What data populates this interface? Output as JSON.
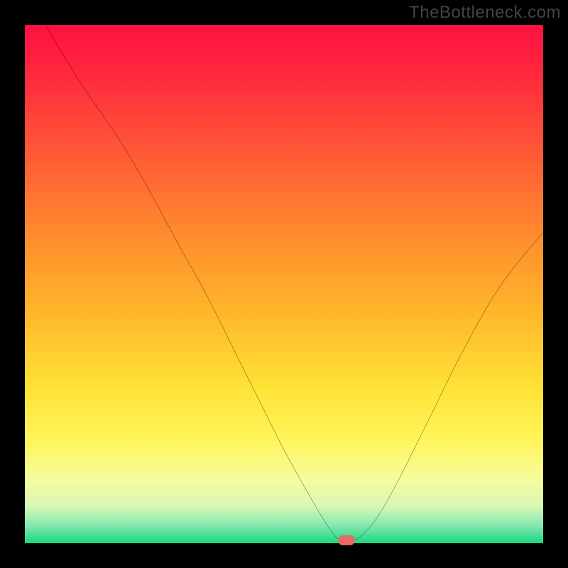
{
  "watermark": "TheBottleneck.com",
  "chart_data": {
    "type": "line",
    "title": "",
    "xlabel": "",
    "ylabel": "",
    "xlim": [
      0,
      100
    ],
    "ylim": [
      0,
      100
    ],
    "grid": false,
    "legend": false,
    "x": [
      4,
      10,
      20,
      30,
      35,
      40,
      45,
      50,
      55,
      58,
      60,
      61.5,
      63,
      65,
      68,
      72,
      78,
      85,
      92,
      100
    ],
    "values": [
      100,
      90,
      75,
      57,
      48,
      38,
      28,
      18,
      9,
      4,
      1.2,
      0.5,
      0.5,
      1.5,
      5,
      12,
      24,
      38,
      50,
      60
    ],
    "marker": {
      "x": 62,
      "y": 0.5
    },
    "gradient_stops": [
      {
        "pos": 0.0,
        "color": "#ff1041"
      },
      {
        "pos": 0.1,
        "color": "#ff2a3d"
      },
      {
        "pos": 0.25,
        "color": "#ff5a36"
      },
      {
        "pos": 0.4,
        "color": "#ff8a2e"
      },
      {
        "pos": 0.55,
        "color": "#ffb52a"
      },
      {
        "pos": 0.7,
        "color": "#ffe236"
      },
      {
        "pos": 0.8,
        "color": "#fff45a"
      },
      {
        "pos": 0.88,
        "color": "#f6fca0"
      },
      {
        "pos": 0.93,
        "color": "#d6f7b4"
      },
      {
        "pos": 0.965,
        "color": "#86e8b0"
      },
      {
        "pos": 1.0,
        "color": "#17d980"
      }
    ]
  }
}
